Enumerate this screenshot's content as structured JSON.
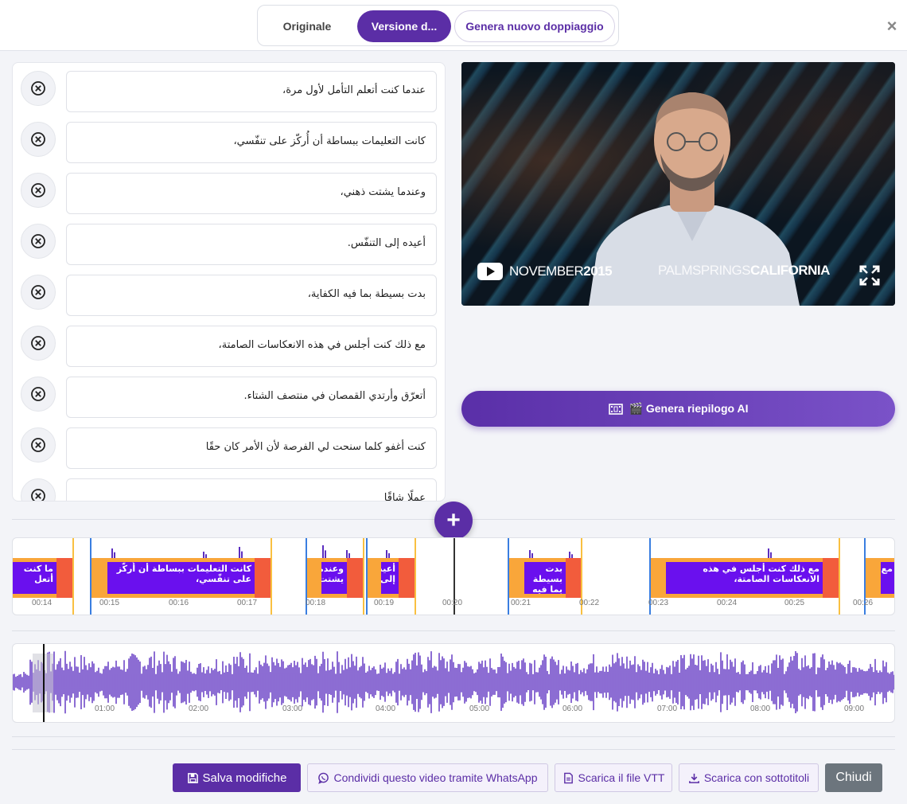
{
  "tabs": {
    "original": "Originale",
    "dubbed": "Versione d...",
    "generate": "Genera nuovo doppiaggio"
  },
  "close_symbol": "×",
  "subtitles": [
    "عندما كنت أتعلم التأمل لأول مرة،",
    "كانت التعليمات ببساطة أن أُركّز على تنفّسي،",
    "وعندما يشتت ذهني،",
    "أعيده إلى التنفّس.",
    "بدت بسيطة بما فيه الكفاية،",
    "مع ذلك كنت أجلس في هذه الانعكاسات الصامتة،",
    "أتعرّق وأرتدي القمصان في منتصف الشتاء.",
    "كنت أغفو كلما سنحت لي الفرصة لأن الأمر كان حقًا",
    "عملًا شاقًا"
  ],
  "video": {
    "caption_left_a": "NOVEMBER",
    "caption_left_b": "2015",
    "caption_right_a": "PALMSPRINGS",
    "caption_right_b": "CALIFORNIA"
  },
  "ai_button": "🎬 Genera riepilogo AI",
  "add_symbol": "+",
  "timeline": {
    "ticks": [
      "00:14",
      "00:15",
      "00:16",
      "00:17",
      "00:18",
      "00:19",
      "00:20",
      "00:21",
      "00:22",
      "00:23",
      "00:24",
      "00:25",
      "00:26"
    ],
    "region_labels": [
      "ما كنت أتعل",
      "كانت التعليمات ببساطة أن أُركّز على تنفّسي،",
      "وعندما يشتت",
      "أعيده إلى",
      "بدت بسيطة بما فيه الكفاية،",
      "مع ذلك كنت أجلس في هذه الانعكاسات الصامتة،",
      "مع"
    ]
  },
  "overview": {
    "ticks": [
      "01:00",
      "02:00",
      "03:00",
      "04:00",
      "05:00",
      "06:00",
      "07:00",
      "08:00",
      "09:00"
    ]
  },
  "buttons": {
    "save": "Salva modifiche",
    "whatsapp": "Condividi questo video tramite WhatsApp",
    "vtt": "Scarica il file VTT",
    "download": "Scarica con sottotitoli",
    "close": "Chiudi"
  },
  "colors": {
    "brand": "#5b2ea6",
    "region_orange": "#f9a63a",
    "region_red": "#f25c3c",
    "region_label": "#6a10ee",
    "waveform": "#5b2ec0"
  }
}
